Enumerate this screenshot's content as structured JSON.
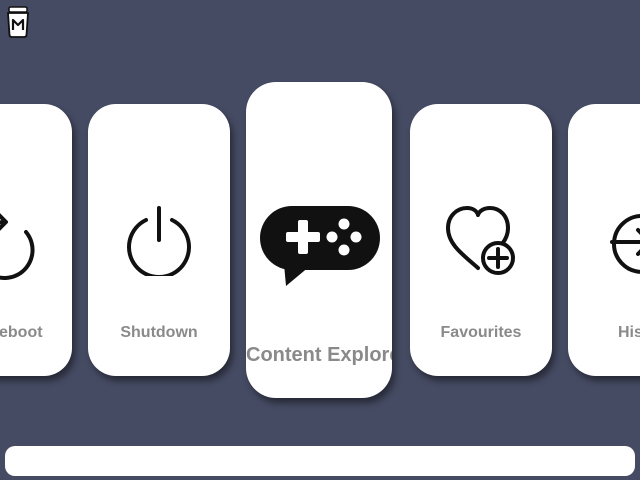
{
  "menu": {
    "items": [
      {
        "id": "reboot",
        "label": "Reboot",
        "icon": "reboot-icon"
      },
      {
        "id": "shutdown",
        "label": "Shutdown",
        "icon": "power-icon"
      },
      {
        "id": "content",
        "label": "Content Explore",
        "icon": "gamepad-chat-icon"
      },
      {
        "id": "fav",
        "label": "Favourites",
        "icon": "heart-plus-icon"
      },
      {
        "id": "history",
        "label": "History",
        "icon": "history-icon"
      }
    ],
    "selected": "Content Explore"
  },
  "colors": {
    "background": "#454b63",
    "card": "#ffffff",
    "label": "#8a8a8a",
    "icon": "#111111"
  }
}
